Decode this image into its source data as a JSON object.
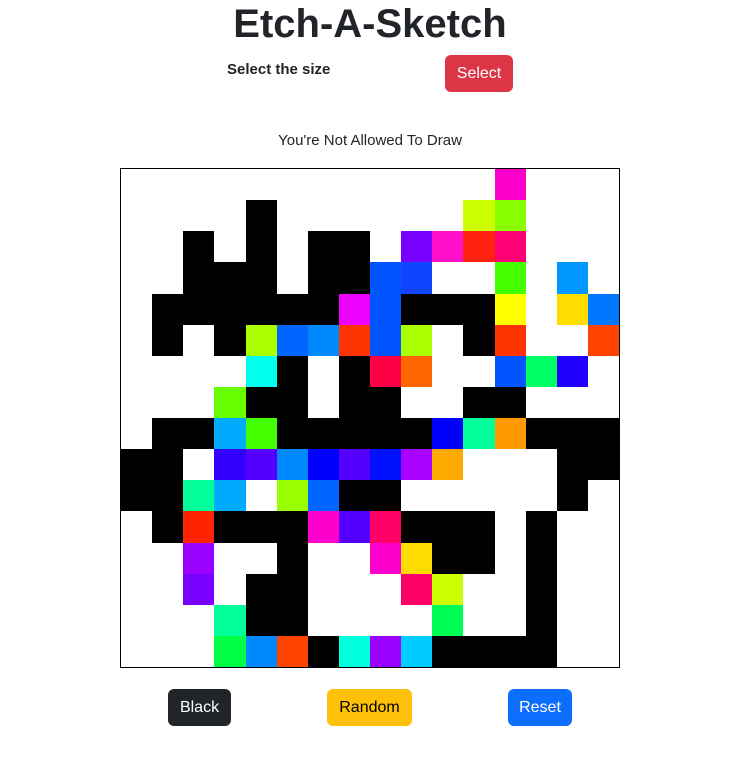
{
  "header": {
    "title": "Etch-A-Sketch"
  },
  "controls": {
    "size_label": "Select the size",
    "select_label": "Select"
  },
  "status": {
    "message": "You're Not Allowed To Draw"
  },
  "footer": {
    "black_label": "Black",
    "random_label": "Random",
    "reset_label": "Reset"
  },
  "colors": {
    "select_button": "#dc3545",
    "black_button": "#212529",
    "random_button": "#ffc107",
    "reset_button": "#0d6efd"
  },
  "grid": {
    "size": 16,
    "palette": {
      "W": "#ffffff",
      "K": "#000000",
      "a": "#ff00cc",
      "b": "#ccff00",
      "c": "#88ff00",
      "d": "#7700ff",
      "e": "#ff11cc",
      "f": "#ff2211",
      "g": "#ff0077",
      "h": "#0055ff",
      "i": "#1144ff",
      "j": "#44ff00",
      "k": "#0099ff",
      "l": "#ee00ff",
      "m": "#ffff00",
      "n": "#ffdd00",
      "o": "#0077ff",
      "p": "#aaff00",
      "q": "#0066ff",
      "r": "#0088ff",
      "s": "#ff3300",
      "t": "#0022ff",
      "u": "#bbff00",
      "v": "#ff4400",
      "w": "#ff5500",
      "x": "#00ffee",
      "y": "#ff0044",
      "z": "#ff6600",
      "A": "#00ff66",
      "B": "#2200ff",
      "C": "#66ff00",
      "D": "#00aaff",
      "E": "#00ff99",
      "F": "#ffaa00",
      "G": "#0000ff",
      "H": "#3300ff",
      "I": "#0011ff",
      "J": "#aa00ff",
      "L": "#ff9900",
      "M": "#00ff99",
      "N": "#99ff00",
      "O": "#ff2200",
      "P": "#ff00cc",
      "Q": "#5500ff",
      "R": "#ff0066",
      "S": "#9900ff",
      "T": "#ffdd00",
      "U": "#7700ff",
      "V": "#ff0066",
      "X": "#ccff00",
      "Y": "#00ff99",
      "Z": "#00ff55",
      "0": "#00ff44",
      "1": "#0088ff",
      "2": "#ff4400",
      "3": "#00ffdd",
      "4": "#9900ff",
      "5": "#00ccff"
    },
    "rows": [
      "WWWWWWWWWWWWaWWW",
      "WWWWKWWWWWWbcWWW",
      "WWKWKWKKWdefgWWW",
      "WWKKKWKKhiWWjWkW",
      "WKKKKKKlhKKKmWno",
      "WKWKpqrshpWKsWWv",
      "WWWWxKWKyzWWhABW",
      "WWWCKKWKKWWKKWWW",
      "WKKDjKKKKKGELKKK",
      "KKWHQrGQIJFWWWKK",
      "KKMDWNqKKWWWWWKW",
      "WKOKKKPQRKKKWKWW",
      "WWSWWKWWPTKKWKWW",
      "WWUWKKWWWRXWWKWW",
      "WWWYKKWWWWZWWKWW",
      "WWW012K345KKKKWW"
    ]
  }
}
